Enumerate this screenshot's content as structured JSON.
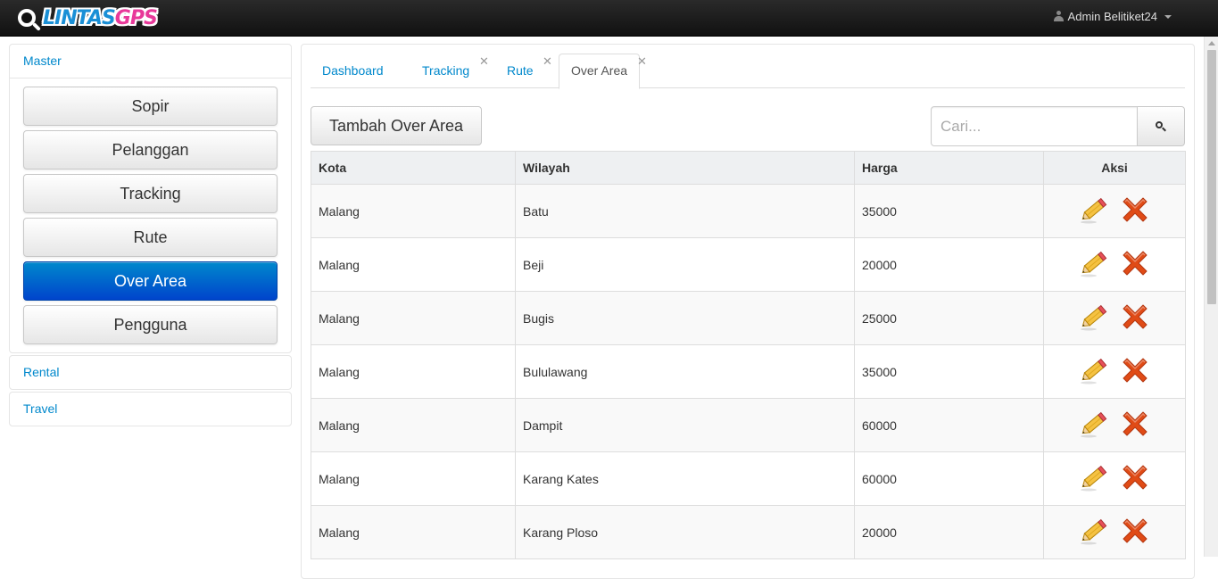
{
  "brand": {
    "part1": "LINTAS",
    "part2": "GPS"
  },
  "user": {
    "name": "Admin Belitiket24"
  },
  "sidebar": {
    "groups": [
      {
        "label": "Master"
      },
      {
        "label": "Rental"
      },
      {
        "label": "Travel"
      }
    ],
    "items": [
      {
        "label": "Sopir"
      },
      {
        "label": "Pelanggan"
      },
      {
        "label": "Tracking"
      },
      {
        "label": "Rute"
      },
      {
        "label": "Over Area"
      },
      {
        "label": "Pengguna"
      }
    ],
    "active_item": "Over Area"
  },
  "tabs": [
    {
      "label": "Dashboard",
      "closable": false
    },
    {
      "label": "Tracking",
      "closable": true
    },
    {
      "label": "Rute",
      "closable": true
    },
    {
      "label": "Over Area",
      "closable": true
    }
  ],
  "active_tab": "Over Area",
  "toolbar": {
    "add_label": "Tambah Over Area",
    "search_placeholder": "Cari..."
  },
  "table": {
    "headers": [
      "Kota",
      "Wilayah",
      "Harga",
      "Aksi"
    ],
    "rows": [
      {
        "kota": "Malang",
        "wilayah": "Batu",
        "harga": "35000"
      },
      {
        "kota": "Malang",
        "wilayah": "Beji",
        "harga": "20000"
      },
      {
        "kota": "Malang",
        "wilayah": "Bugis",
        "harga": "25000"
      },
      {
        "kota": "Malang",
        "wilayah": "Bululawang",
        "harga": "35000"
      },
      {
        "kota": "Malang",
        "wilayah": "Dampit",
        "harga": "60000"
      },
      {
        "kota": "Malang",
        "wilayah": "Karang Kates",
        "harga": "60000"
      },
      {
        "kota": "Malang",
        "wilayah": "Karang Ploso",
        "harga": "20000"
      }
    ]
  },
  "icons": {
    "edit": "pencil-icon",
    "delete": "delete-x-icon",
    "search": "search-icon",
    "user": "user-icon"
  },
  "colors": {
    "accent": "#0088cc",
    "active_button": "#0055cc",
    "brand_blue": "#1a8fd6",
    "brand_pink": "#e8399a",
    "delete": "#e04b16"
  }
}
